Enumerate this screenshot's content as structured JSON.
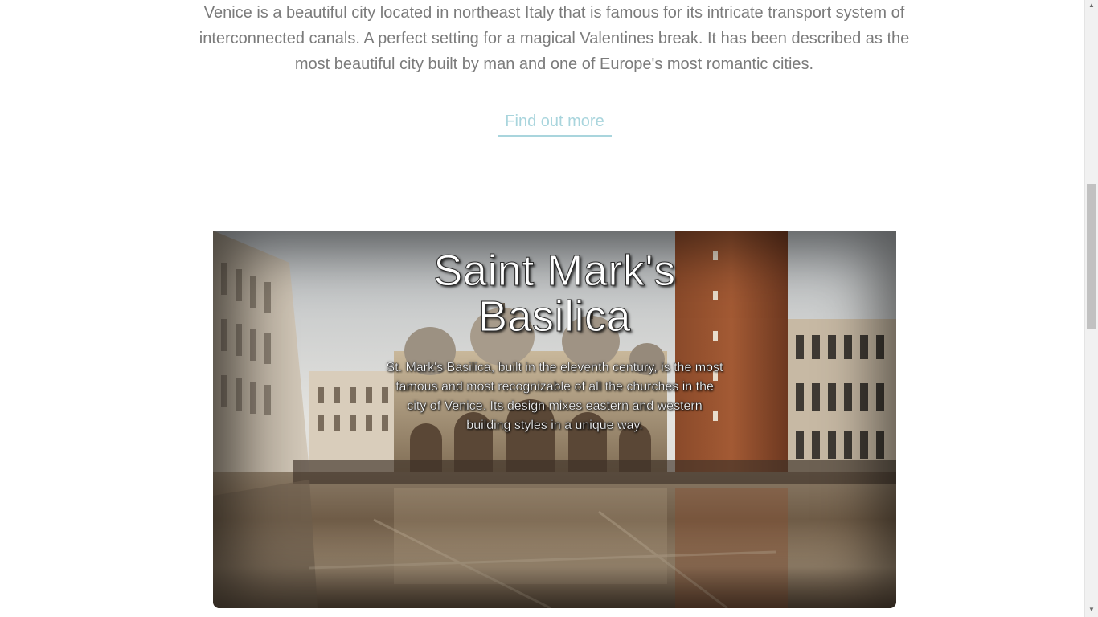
{
  "intro": {
    "line1": "Venice is a beautiful city located in northeast Italy that is famous for its intricate transport system of",
    "line2": "interconnected canals. A perfect setting for a magical Valentines break. It has been described as the",
    "line3": "most beautiful city built by man and one of Europe's most romantic cities."
  },
  "cta": {
    "label": "Find out more",
    "color": "#a9d5dd"
  },
  "feature": {
    "title_line1": "Saint Mark's",
    "title_line2": "Basilica",
    "desc_line1": "St. Mark's Basilica, built in the eleventh century, is the most",
    "desc_line2": "famous and most recognizable of all the churches in the",
    "desc_line3": "city of Venice. Its design mixes eastern and western",
    "desc_line4": "building styles in a unique way.",
    "image_subject": "Piazza San Marco with flooded square reflections, basilica domes and campanile tower"
  },
  "colors": {
    "body_text": "#7b7b7b",
    "accent": "#a9d5dd",
    "overlay_text": "#ffffff"
  },
  "icons": {
    "scroll_up": "triangle-up",
    "scroll_down": "triangle-down"
  }
}
